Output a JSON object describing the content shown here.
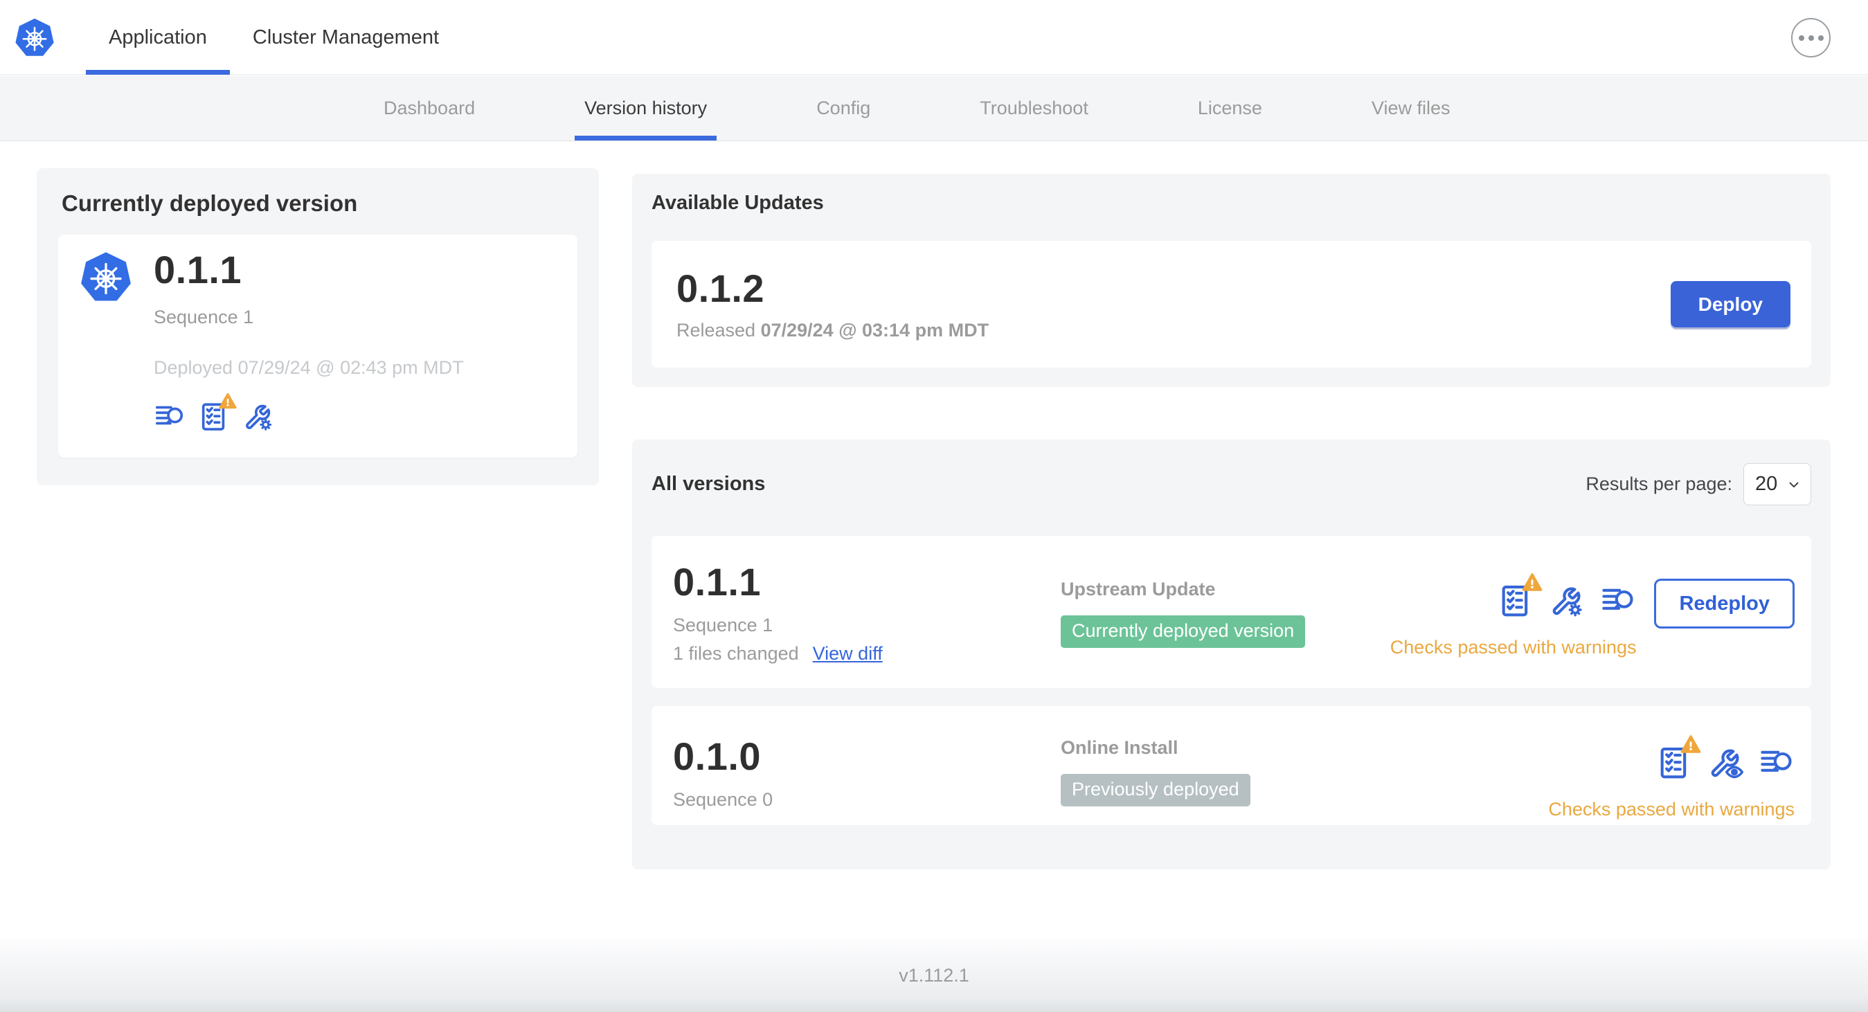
{
  "header": {
    "tabs": [
      {
        "label": "Application",
        "active": true
      },
      {
        "label": "Cluster Management",
        "active": false
      }
    ]
  },
  "subnav": {
    "items": [
      {
        "label": "Dashboard",
        "active": false
      },
      {
        "label": "Version history",
        "active": true
      },
      {
        "label": "Config",
        "active": false
      },
      {
        "label": "Troubleshoot",
        "active": false
      },
      {
        "label": "License",
        "active": false
      },
      {
        "label": "View files",
        "active": false
      }
    ]
  },
  "deployed": {
    "title": "Currently deployed version",
    "version": "0.1.1",
    "sequence": "Sequence 1",
    "deployed_at": "Deployed 07/29/24 @ 02:43 pm MDT"
  },
  "updates": {
    "title": "Available Updates",
    "version": "0.1.2",
    "released_prefix": "Released",
    "released_date": "07/29/24 @ 03:14 pm MDT",
    "deploy_label": "Deploy"
  },
  "all_versions": {
    "title": "All versions",
    "results_per_page_label": "Results per page:",
    "results_per_page_value": "20",
    "rows": [
      {
        "version": "0.1.1",
        "sequence": "Sequence 1",
        "files_changed": "1 files changed",
        "view_diff_label": "View diff",
        "source": "Upstream Update",
        "badge": "Currently deployed version",
        "badge_type": "success",
        "checks": "Checks passed with warnings",
        "action_label": "Redeploy"
      },
      {
        "version": "0.1.0",
        "sequence": "Sequence 0",
        "source": "Online Install",
        "badge": "Previously deployed",
        "badge_type": "muted",
        "checks": "Checks passed with warnings"
      }
    ]
  },
  "footer": {
    "app_version": "v1.112.1"
  },
  "colors": {
    "accent_blue": "#3b6bde",
    "kubernetes_blue": "#326de6",
    "icon_blue": "#3566d7",
    "success_green": "#6cc398",
    "muted_badge_gray": "#b6c0c3",
    "warning_amber": "#eaa83f",
    "warning_triangle": "#efa63b",
    "card_gray": "#f4f5f7"
  }
}
